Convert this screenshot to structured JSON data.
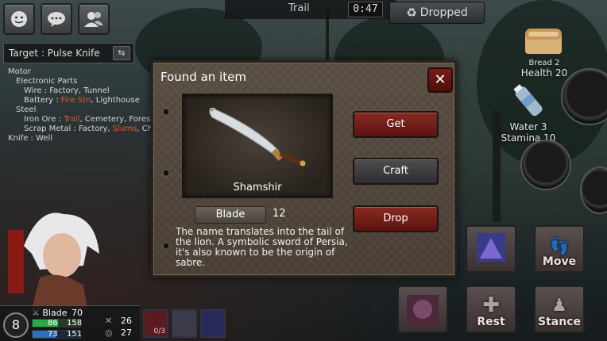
{
  "top_bar": {
    "icons": [
      "emote-icon",
      "chat-icon",
      "party-icon"
    ],
    "location": "Trail",
    "timer": "0:47",
    "dropped_label": "Dropped"
  },
  "target": {
    "label": "Target : Pulse Knife"
  },
  "recipe_tree": [
    {
      "text": "Motor",
      "indent": 0
    },
    {
      "text": "Electronic Parts",
      "indent": 1
    },
    {
      "text": "Wire : Factory, Tunnel",
      "indent": 2
    },
    {
      "text": "Battery : ",
      "highlight": "Fire Stn",
      "rest": ", Lighthouse",
      "indent": 2
    },
    {
      "text": "Steel",
      "indent": 1
    },
    {
      "text": "Iron Ore : ",
      "highlight": "Trail",
      "rest": ", Cemetery, Forest",
      "indent": 2
    },
    {
      "text": "Scrap Metal : Factory, ",
      "highlight": "Slums",
      "rest": ", Ch",
      "indent": 2
    },
    {
      "text": "Knife : Well",
      "indent": 0
    }
  ],
  "side_items": {
    "bread": {
      "name": "Bread 2",
      "effect": "Health 20"
    },
    "water": {
      "name": "Water 3",
      "effect": "Stamina 10"
    }
  },
  "actions": {
    "move": "Move",
    "rest": "Rest",
    "stance": "Stance"
  },
  "status": {
    "level": "8",
    "weapon": "Blade",
    "weapon_value": "70",
    "hp_current": "86",
    "hp_max": "158",
    "sp_current": "73",
    "sp_max": "151",
    "attack": "26",
    "defense": "27",
    "skill_count": "0/3",
    "hp_fraction": 0.54,
    "sp_fraction": 0.48
  },
  "dialog": {
    "title": "Found an item",
    "close_label": "✕",
    "item_name": "Shamshir",
    "category": "Blade",
    "category_value": "12",
    "description": "The name translates into the tail of the lion. A symbolic sword of Persia, it's also known to be the origin of sabre.",
    "buttons": {
      "get": "Get",
      "craft": "Craft",
      "drop": "Drop"
    }
  },
  "colors": {
    "accent_red": "#8a2a22",
    "highlight_orange": "#e05a2a",
    "hp_bar": "#2fa84a",
    "sp_bar": "#2a6fc0"
  }
}
